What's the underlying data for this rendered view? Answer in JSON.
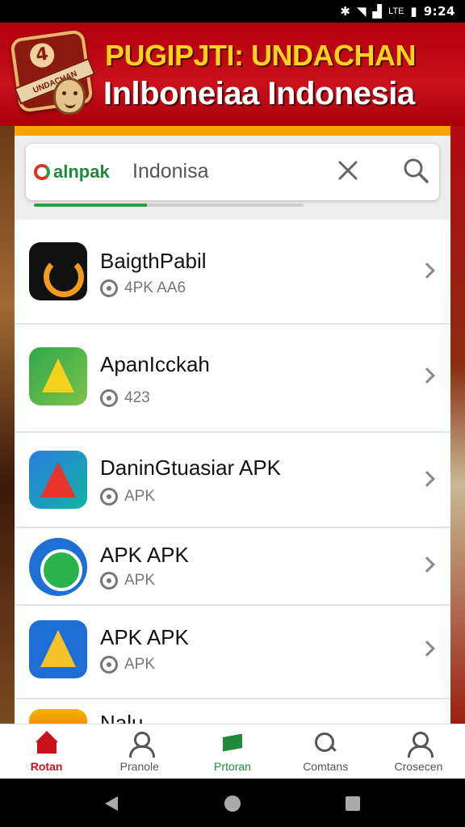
{
  "status_bar": {
    "network": "LTE",
    "time": "9:24"
  },
  "header": {
    "badge_number": "4",
    "badge_text": "UNDACHAN",
    "title": "PUGIPJTI: UNDACHAN",
    "subtitle": "Inlboneiaa Indonesia"
  },
  "search": {
    "logo_text": "alnpak",
    "query": "Indonisa",
    "progress": 0.42
  },
  "apps": [
    {
      "name": "BaigthPabil",
      "meta": "4PK AA6"
    },
    {
      "name": "ApanIcckah",
      "meta": "423"
    },
    {
      "name": "DaninGtuasiar APK",
      "meta": "APK"
    },
    {
      "name": "APK APK",
      "meta": "APK"
    },
    {
      "name": "APK APK",
      "meta": "APK"
    },
    {
      "name": "Nalu",
      "meta": ""
    }
  ],
  "bottom_nav": [
    {
      "label": "Rotan"
    },
    {
      "label": "Pranole"
    },
    {
      "label": "Prtoran"
    },
    {
      "label": "Comtans"
    },
    {
      "label": "Crosecen"
    }
  ],
  "colors": {
    "brand_red": "#c8111b",
    "accent_yellow": "#ffd21f",
    "accent_green": "#1f8a3a"
  }
}
